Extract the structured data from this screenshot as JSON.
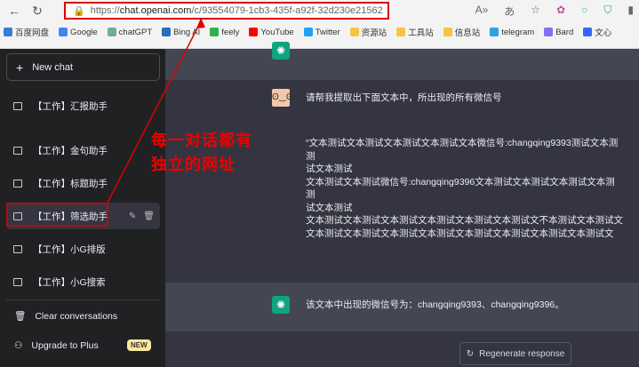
{
  "browser": {
    "url_prefix": "https://",
    "url_domain": "chat.openai.com",
    "url_path": "/c/93554079-1cb3-435f-a92f-32d230e21562",
    "bookmarks": [
      {
        "label": "百度网盘",
        "color": "#3a7bd5"
      },
      {
        "label": "Google",
        "color": "#4285f4"
      },
      {
        "label": "chatGPT",
        "color": "#74aa9c"
      },
      {
        "label": "Bing AI",
        "color": "#2a6ebb"
      },
      {
        "label": "feely",
        "color": "#2bb24c"
      },
      {
        "label": "YouTube",
        "color": "#ff0000"
      },
      {
        "label": "Twitter",
        "color": "#1da1f2"
      },
      {
        "label": "资源站",
        "color": "#f5c542"
      },
      {
        "label": "工具站",
        "color": "#f5c542"
      },
      {
        "label": "信息站",
        "color": "#f5c542"
      },
      {
        "label": "telegram",
        "color": "#2aa3df"
      },
      {
        "label": "Bard",
        "color": "#8a6bf0"
      },
      {
        "label": "文心",
        "color": "#3366ff"
      }
    ]
  },
  "sidebar": {
    "new_chat": "New chat",
    "items": [
      {
        "label": "【工作】汇报助手"
      },
      {
        "label": "【工作】金句助手"
      },
      {
        "label": "【工作】标题助手"
      },
      {
        "label": "【工作】筛选助手"
      },
      {
        "label": "【工作】小G排版"
      },
      {
        "label": "【工作】小G搜索"
      }
    ],
    "clear": "Clear conversations",
    "upgrade": "Upgrade to Plus",
    "new_badge": "NEW"
  },
  "chat": {
    "user_prompt": "请帮我提取出下面文本中，所出现的所有微信号",
    "user_text": [
      "“文本测试文本测试文本测试文本测试文本微信号:changqing9393测试文本测",
      "测",
      "试文本测试",
      "文本测试文本测试微信号:changqing9396文本测试文本测试文本测试文本测",
      "测",
      "试文本测试",
      "文本测试文本测试文本测试文本测试文本测试文本测试文不本测试文本测试文",
      "文本测试文本测试文本测试文本测试文本测试文本测试文本测试文本测试文"
    ],
    "assistant_reply": "该文本中出现的微信号为：changqing9393、changqing9396。",
    "regenerate": "Regenerate response"
  },
  "annotation": {
    "line1": "每一对话都有",
    "line2": "独立的网址"
  }
}
